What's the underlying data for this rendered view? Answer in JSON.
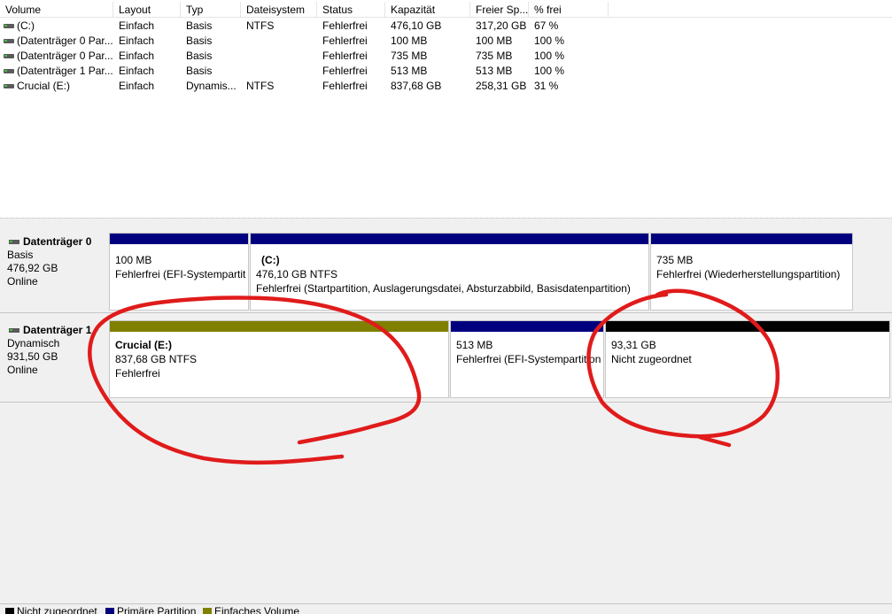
{
  "columns": [
    "Volume",
    "Layout",
    "Typ",
    "Dateisystem",
    "Status",
    "Kapazität",
    "Freier Sp...",
    "% frei"
  ],
  "volumes": [
    {
      "name": " (C:)",
      "layout": "Einfach",
      "typ": "Basis",
      "fs": "NTFS",
      "status": "Fehlerfrei",
      "capacity": "476,10 GB",
      "free": "317,20 GB",
      "pct": "67 %"
    },
    {
      "name": "(Datenträger 0 Par...",
      "layout": "Einfach",
      "typ": "Basis",
      "fs": "",
      "status": "Fehlerfrei",
      "capacity": "100 MB",
      "free": "100 MB",
      "pct": "100 %"
    },
    {
      "name": "(Datenträger 0 Par...",
      "layout": "Einfach",
      "typ": "Basis",
      "fs": "",
      "status": "Fehlerfrei",
      "capacity": "735 MB",
      "free": "735 MB",
      "pct": "100 %"
    },
    {
      "name": "(Datenträger 1 Par...",
      "layout": "Einfach",
      "typ": "Basis",
      "fs": "",
      "status": "Fehlerfrei",
      "capacity": "513 MB",
      "free": "513 MB",
      "pct": "100 %"
    },
    {
      "name": "Crucial (E:)",
      "layout": "Einfach",
      "typ": "Dynamis...",
      "fs": "NTFS",
      "status": "Fehlerfrei",
      "capacity": "837,68 GB",
      "free": "258,31 GB",
      "pct": "31 %"
    }
  ],
  "disks": [
    {
      "title": "Datenträger 0",
      "type": "Basis",
      "size": "476,92 GB",
      "state": "Online",
      "partitions": [
        {
          "bar": "primary",
          "name": "",
          "size": "100 MB",
          "status": "Fehlerfrei (EFI-Systempartit"
        },
        {
          "bar": "primary",
          "name": "(C:)",
          "size": "476,10 GB NTFS",
          "status": "Fehlerfrei (Startpartition, Auslagerungsdatei, Absturzabbild, Basisdatenpartition)"
        },
        {
          "bar": "primary",
          "name": "",
          "size": "735 MB",
          "status": "Fehlerfrei (Wiederherstellungspartition)"
        }
      ]
    },
    {
      "title": "Datenträger 1",
      "type": "Dynamisch",
      "size": "931,50 GB",
      "state": "Online",
      "partitions": [
        {
          "bar": "simple",
          "name": "Crucial  (E:)",
          "size": "837,68 GB NTFS",
          "status": "Fehlerfrei"
        },
        {
          "bar": "primary",
          "name": "",
          "size": "513 MB",
          "status": "Fehlerfrei (EFI-Systempartition"
        },
        {
          "bar": "unallocated",
          "name": "",
          "size": "93,31 GB",
          "status": "Nicht zugeordnet"
        }
      ]
    }
  ],
  "legend": [
    {
      "label": "Nicht zugeordnet",
      "color": "#000000"
    },
    {
      "label": "Primäre Partition",
      "color": "#00007f"
    },
    {
      "label": "Einfaches Volume",
      "color": "#808000"
    }
  ],
  "colors": {
    "primary": "#00007f",
    "simple": "#808000",
    "unallocated": "#000000",
    "annotation": "#e01b1b"
  }
}
